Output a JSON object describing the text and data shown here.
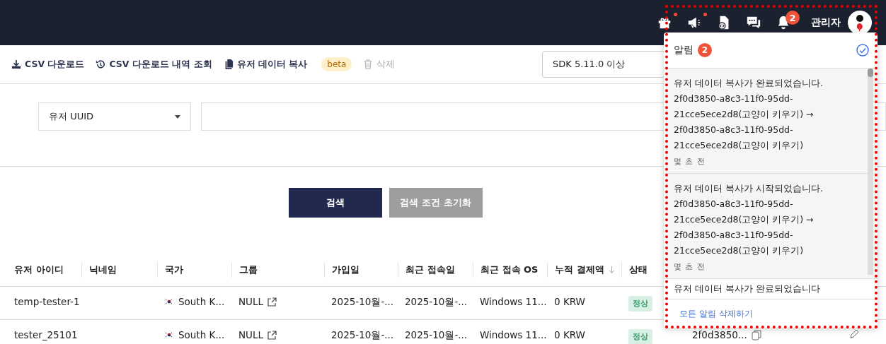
{
  "topbar": {
    "icons": [
      {
        "kind": "gift",
        "dot": true
      },
      {
        "kind": "megaphone",
        "dot": true
      },
      {
        "kind": "document",
        "dot": false
      },
      {
        "kind": "chat",
        "dot": false
      },
      {
        "kind": "bell",
        "dot": false,
        "badge": "2"
      }
    ],
    "user": "관리자"
  },
  "toolbar": {
    "actions": [
      {
        "kind": "download",
        "label": "CSV 다운로드",
        "disabled": false
      },
      {
        "kind": "history",
        "label": "CSV 다운로드 내역 조회",
        "disabled": false
      },
      {
        "kind": "copy",
        "label": "유저 데이터 복사",
        "badge": "beta",
        "disabled": false
      },
      {
        "kind": "trash",
        "label": "삭제",
        "disabled": true
      }
    ],
    "sdk_select": "SDK 5.11.0 이상"
  },
  "filter": {
    "field_select": "유저 UUID"
  },
  "buttons": [
    {
      "kind": "primary",
      "label": "검색"
    },
    {
      "kind": "secondary",
      "label": "검색 조건 초기화"
    }
  ],
  "table": {
    "columns": [
      {
        "label": "유저 아이디",
        "sortable": false
      },
      {
        "label": "닉네임",
        "sortable": false
      },
      {
        "label": "국가",
        "sortable": false
      },
      {
        "label": "그룹",
        "sortable": false
      },
      {
        "label": "가입일",
        "sortable": false
      },
      {
        "label": "최근 접속일",
        "sortable": false
      },
      {
        "label": "최근 접속 OS",
        "sortable": false
      },
      {
        "label": "누적 결제액",
        "sortable": true
      },
      {
        "label": "상태",
        "sortable": false
      }
    ],
    "rows": [
      {
        "user_id": "temp-tester-1",
        "nickname": "",
        "country": "South K...",
        "group": "NULL",
        "joined": "2025-10월-...",
        "last_access": "2025-10월-...",
        "os": "Windows 11...",
        "payment": "0 KRW",
        "status": "정상"
      },
      {
        "user_id": "tester_25101",
        "nickname": "",
        "country": "South K...",
        "group": "NULL",
        "joined": "2025-10월-...",
        "last_access": "2025-10월-...",
        "os": "Windows 11...",
        "payment": "0 KRW",
        "status": "정상",
        "uuid": "2f0d3850...",
        "editable": true
      }
    ]
  },
  "notifications": {
    "title": "알림",
    "count": "2",
    "items": [
      {
        "message": "유저 데이터 복사가 완료되었습니다. 2f0d3850-a8c3-11f0-95dd-21cce5ece2d8(고양이 키우기) → 2f0d3850-a8c3-11f0-95dd-21cce5ece2d8(고양이 키우기)",
        "time": "몇 초 전",
        "read": false
      },
      {
        "message": "유저 데이터 복사가 시작되었습니다. 2f0d3850-a8c3-11f0-95dd-21cce5ece2d8(고양이 키우기) → 2f0d3850-a8c3-11f0-95dd-21cce5ece2d8(고양이 키우기)",
        "time": "몇 초 전",
        "read": false
      },
      {
        "message": "유저 데이터 복사가 완료되었습니다",
        "read": true
      }
    ],
    "footer": "모든 알림 삭제하기"
  }
}
